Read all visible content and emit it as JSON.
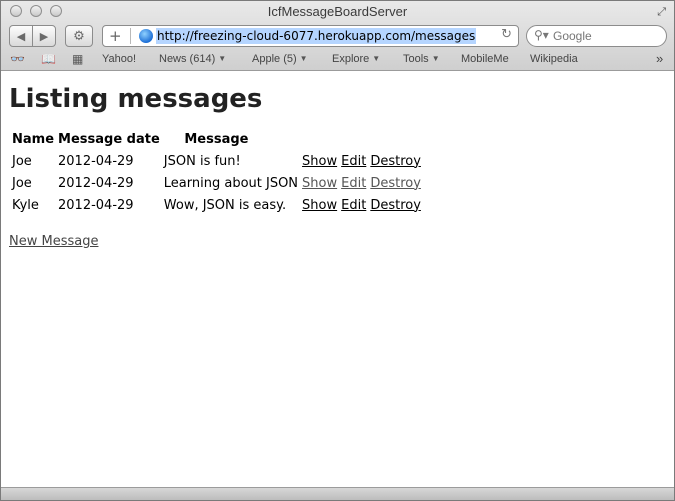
{
  "window": {
    "title": "IcfMessageBoardServer"
  },
  "toolbar": {
    "url": "http://freezing-cloud-6077.herokuapp.com/messages",
    "search_placeholder": "Google"
  },
  "bookmarks": [
    {
      "label": "Yahoo!",
      "menu": false
    },
    {
      "label": "News (614)",
      "menu": true
    },
    {
      "label": "Apple (5)",
      "menu": true
    },
    {
      "label": "Explore",
      "menu": true
    },
    {
      "label": "Tools",
      "menu": true
    },
    {
      "label": "MobileMe",
      "menu": false
    },
    {
      "label": "Wikipedia",
      "menu": false
    }
  ],
  "page": {
    "heading": "Listing messages",
    "columns": [
      "Name",
      "Message date",
      "Message"
    ],
    "rows": [
      {
        "name": "Joe",
        "date": "2012-04-29",
        "message": "JSON is fun!"
      },
      {
        "name": "Joe",
        "date": "2012-04-29",
        "message": "Learning about JSON"
      },
      {
        "name": "Kyle",
        "date": "2012-04-29",
        "message": "Wow, JSON is easy."
      }
    ],
    "actions": {
      "show": "Show",
      "edit": "Edit",
      "destroy": "Destroy"
    },
    "new_link": "New Message"
  }
}
